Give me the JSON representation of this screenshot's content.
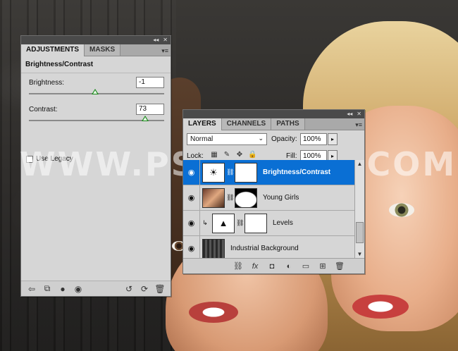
{
  "watermark": "WWW.PSD-DUDE.COM",
  "adjustments_panel": {
    "tabs": [
      "ADJUSTMENTS",
      "MASKS"
    ],
    "title": "Brightness/Contrast",
    "brightness": {
      "label": "Brightness:",
      "value": "-1",
      "slider_fraction": 0.49
    },
    "contrast": {
      "label": "Contrast:",
      "value": "73",
      "slider_fraction": 0.86
    },
    "use_legacy": {
      "label": "Use Legacy",
      "checked": false
    }
  },
  "layers_panel": {
    "tabs": [
      "LAYERS",
      "CHANNELS",
      "PATHS"
    ],
    "blend_mode": "Normal",
    "opacity_label": "Opacity:",
    "opacity_value": "100%",
    "lock_label": "Lock:",
    "fill_label": "Fill:",
    "fill_value": "100%",
    "layers": [
      {
        "name": "Brightness/Contrast",
        "selected": true
      },
      {
        "name": "Young Girls",
        "selected": false
      },
      {
        "name": "Levels",
        "selected": false
      },
      {
        "name": "Industrial Background",
        "selected": false
      }
    ]
  },
  "colors": {
    "selection": "#0a6fd4",
    "panel": "#d6d6d6",
    "thumb_green": "#1a8a1a"
  }
}
